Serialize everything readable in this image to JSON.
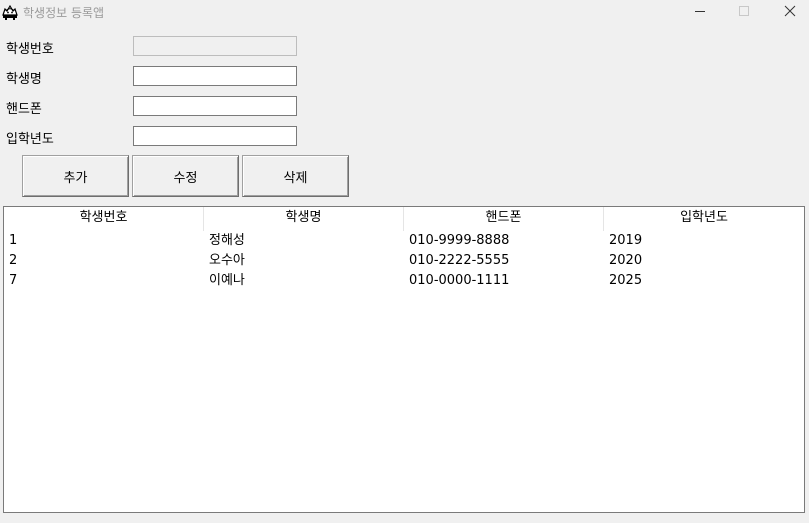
{
  "window": {
    "title": "학생정보 등록앱",
    "icon": "gnu-app-icon",
    "controls": [
      "minimize-icon",
      "maximize-icon",
      "close-icon"
    ]
  },
  "form": {
    "fields": [
      {
        "label": "학생번호",
        "value": "",
        "placeholder": "",
        "disabled": true
      },
      {
        "label": "학생명",
        "value": "",
        "placeholder": "",
        "disabled": false
      },
      {
        "label": "핸드폰",
        "value": "",
        "placeholder": "",
        "disabled": false
      },
      {
        "label": "입학년도",
        "value": "",
        "placeholder": "",
        "disabled": false
      }
    ]
  },
  "buttons": {
    "add_label": "추가",
    "edit_label": "수정",
    "delete_label": "삭제"
  },
  "table": {
    "columns": [
      "학생번호",
      "학생명",
      "핸드폰",
      "입학년도"
    ],
    "rows": [
      [
        "1",
        "정해성",
        "010-9999-8888",
        "2019"
      ],
      [
        "2",
        "오수아",
        "010-2222-5555",
        "2020"
      ],
      [
        "7",
        "이예나",
        "010-0000-1111",
        "2025"
      ]
    ]
  }
}
